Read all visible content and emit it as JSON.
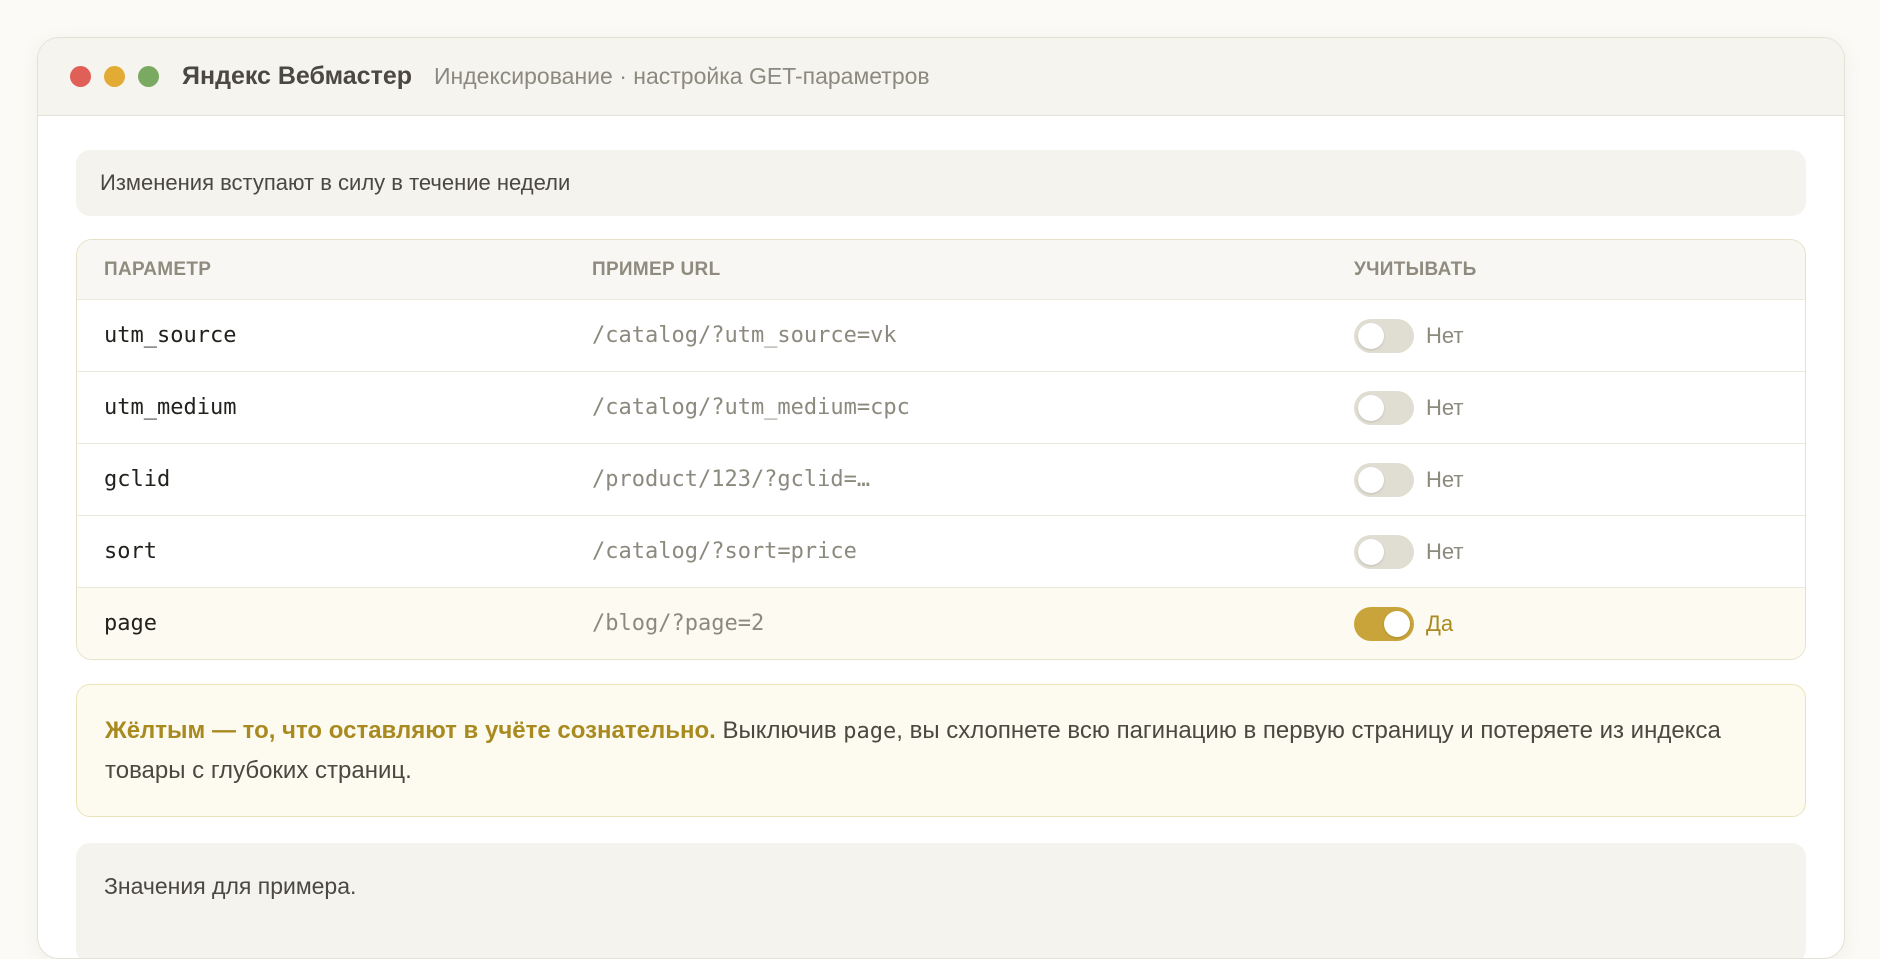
{
  "window": {
    "app_name": "Яндекс Вебмастер",
    "breadcrumb": "Индексирование · настройка GET-параметров"
  },
  "notice": "Изменения вступают в силу в течение недели",
  "table": {
    "headers": [
      "Параметр",
      "Пример URL",
      "Учитывать"
    ],
    "rows": [
      {
        "param": "utm_source",
        "url": "/catalog/?utm_source=vk",
        "enabled": false,
        "state": "Нет"
      },
      {
        "param": "utm_medium",
        "url": "/catalog/?utm_medium=cpc",
        "enabled": false,
        "state": "Нет"
      },
      {
        "param": "gclid",
        "url": "/product/123/?gclid=…",
        "enabled": false,
        "state": "Нет"
      },
      {
        "param": "sort",
        "url": "/catalog/?sort=price",
        "enabled": false,
        "state": "Нет"
      },
      {
        "param": "page",
        "url": "/blog/?page=2",
        "enabled": true,
        "state": "Да"
      }
    ]
  },
  "callout": {
    "strong": "Жёлтым — то, что оставляют в учёте сознательно.",
    "text_before": " Выключив ",
    "code": "page",
    "text_after": ", вы схлопнете всю пагинацию в первую страницу и потеряете из индекса товары с глубоких страниц."
  },
  "footer_note": "Значения для примера.",
  "colors": {
    "accent": "#c8a43a",
    "dot_red": "#e05f57",
    "dot_yellow": "#e2ab33",
    "dot_green": "#7aaa62"
  }
}
